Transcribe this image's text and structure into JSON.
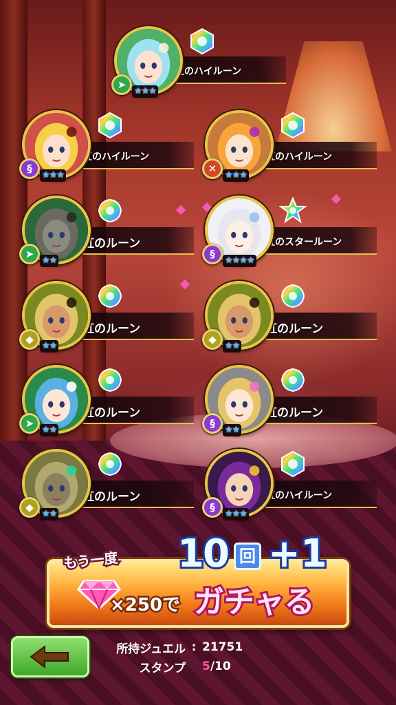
{
  "results": [
    {
      "id": "c1",
      "rune": "虹のハイルーン",
      "rune_type": "high",
      "stars": "★★★",
      "element": "wind",
      "element_color": "#2fa84a",
      "art": "cyan-hair"
    },
    {
      "id": "c2",
      "rune": "虹のハイルーン",
      "rune_type": "high",
      "stars": "★★★",
      "element": "dark",
      "element_color": "#8a3ad0",
      "art": "blonde-hat"
    },
    {
      "id": "c3",
      "rune": "虹のハイルーン",
      "rune_type": "high",
      "stars": "★★★",
      "element": "fire",
      "element_color": "#d0482a",
      "art": "pink-hat"
    },
    {
      "id": "c4",
      "rune": "虹のルーン",
      "rune_type": "normal",
      "stars": "★★",
      "element": "wind",
      "element_color": "#2fa84a",
      "art": "cat"
    },
    {
      "id": "c5",
      "rune": "虹のスタールーン",
      "rune_type": "star",
      "stars": "★★★★",
      "element": "dark",
      "element_color": "#8a3ad0",
      "art": "silver-hair"
    },
    {
      "id": "c6",
      "rune": "虹のルーン",
      "rune_type": "normal",
      "stars": "★★",
      "element": "earth",
      "element_color": "#b0a020",
      "art": "eyepatch"
    },
    {
      "id": "c7",
      "rune": "虹のルーン",
      "rune_type": "normal",
      "stars": "★★",
      "element": "earth",
      "element_color": "#b0a020",
      "art": "eyepatch"
    },
    {
      "id": "c8",
      "rune": "虹のルーン",
      "rune_type": "normal",
      "stars": "★★",
      "element": "wind",
      "element_color": "#2fa84a",
      "art": "blue-hair"
    },
    {
      "id": "c9",
      "rune": "虹のルーン",
      "rune_type": "normal",
      "stars": "★★",
      "element": "dark",
      "element_color": "#8a3ad0",
      "art": "flower-girl"
    },
    {
      "id": "c10",
      "rune": "虹のルーン",
      "rune_type": "normal",
      "stars": "★★",
      "element": "earth",
      "element_color": "#b0a020",
      "art": "knight"
    },
    {
      "id": "c11",
      "rune": "虹のハイルーン",
      "rune_type": "high",
      "stars": "★★★",
      "element": "dark",
      "element_color": "#8a3ad0",
      "art": "purple-hair"
    }
  ],
  "gacha_button": {
    "again_label": "もう一度",
    "count_label": "10",
    "kai_label": "回",
    "plus_label": "+1",
    "cost_label": "×250で",
    "action_label": "ガチャる",
    "gem_icon": "jewel-icon"
  },
  "back_button": {
    "icon": "back-arrow-icon"
  },
  "status": {
    "jewel_label": "所持ジュエル",
    "jewel_sep": ":",
    "jewel_value": "21751",
    "stamp_label": "スタンプ",
    "stamp_current": "5",
    "stamp_total": "/10"
  }
}
